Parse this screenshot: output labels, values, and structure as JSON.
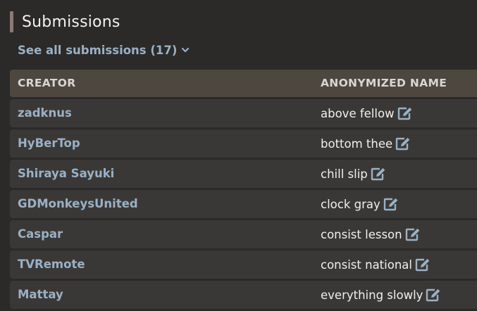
{
  "section": {
    "title": "Submissions",
    "see_all_label": "See all submissions (17)"
  },
  "table": {
    "headers": {
      "creator": "CREATOR",
      "anonymized_name": "ANONYMIZED NAME"
    },
    "rows": [
      {
        "creator": "zadknus",
        "anonymized_name": "above fellow"
      },
      {
        "creator": "HyBerTop",
        "anonymized_name": "bottom thee"
      },
      {
        "creator": "Shiraya Sayuki",
        "anonymized_name": "chill slip"
      },
      {
        "creator": "GDMonkeysUnited",
        "anonymized_name": "clock gray"
      },
      {
        "creator": "Caspar",
        "anonymized_name": "consist lesson"
      },
      {
        "creator": "TVRemote",
        "anonymized_name": "consist national"
      },
      {
        "creator": "Mattay",
        "anonymized_name": "everything slowly"
      }
    ]
  },
  "icons": {
    "see_all": "chevron-down-icon",
    "row_action": "edit-icon"
  },
  "colors": {
    "background": "#2b2a28",
    "header_row": "#4d4740",
    "data_row": "#3a3836",
    "link": "#9ab1c4",
    "section_accent": "#8a7a75"
  }
}
